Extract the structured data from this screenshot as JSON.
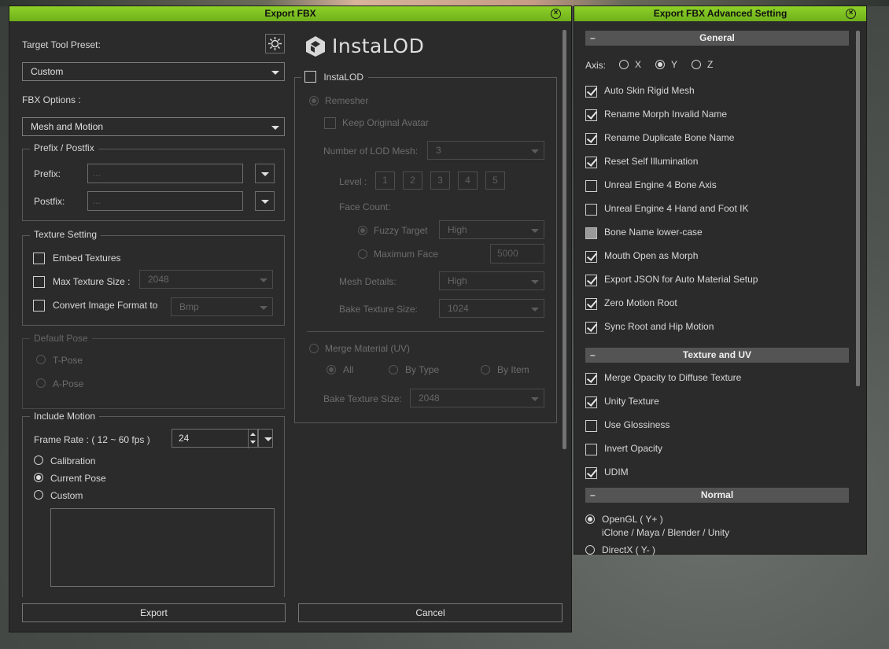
{
  "export_window": {
    "title": "Export FBX",
    "target_tool_preset_label": "Target Tool Preset:",
    "preset_value": "Custom",
    "fbx_options_label": "FBX Options :",
    "fbx_options_value": "Mesh and Motion",
    "prefix_group": {
      "title": "Prefix / Postfix",
      "prefix_label": "Prefix:",
      "prefix_placeholder": "...",
      "postfix_label": "Postfix:",
      "postfix_placeholder": "..."
    },
    "texture_group": {
      "title": "Texture Setting",
      "embed": "Embed Textures",
      "max_size": "Max Texture Size :",
      "max_size_value": "2048",
      "convert": "Convert Image Format to",
      "convert_value": "Bmp"
    },
    "pose_group": {
      "title": "Default Pose",
      "t_pose": "T-Pose",
      "a_pose": "A-Pose"
    },
    "motion_group": {
      "title": "Include Motion",
      "frame_rate_label": "Frame Rate : ( 12 ~ 60 fps )",
      "frame_rate_value": "24",
      "calibration": "Calibration",
      "current_pose": "Current Pose",
      "custom": "Custom"
    },
    "instalod": {
      "logo_text": "InstaLOD",
      "checkbox_label": "InstaLOD",
      "remesher": "Remesher",
      "keep_original": "Keep Original Avatar",
      "lod_count_label": "Number of LOD Mesh:",
      "lod_count_value": "3",
      "level_label": "Level :",
      "levels": [
        "1",
        "2",
        "3",
        "4",
        "5"
      ],
      "face_count_label": "Face Count:",
      "fuzzy_target": "Fuzzy Target",
      "fuzzy_value": "High",
      "max_face": "Maximum Face",
      "max_face_value": "5000",
      "mesh_details_label": "Mesh Details:",
      "mesh_details_value": "High",
      "bake_size_label": "Bake Texture Size:",
      "bake_size_value": "1024",
      "merge_material": "Merge Material (UV)",
      "all": "All",
      "by_type": "By Type",
      "by_item": "By Item",
      "merge_bake_label": "Bake Texture Size:",
      "merge_bake_value": "2048"
    },
    "export_button": "Export",
    "cancel_button": "Cancel"
  },
  "advanced_window": {
    "title": "Export FBX Advanced Setting",
    "general_header": "General",
    "axis_label": "Axis:",
    "axis_x": "X",
    "axis_y": "Y",
    "axis_z": "Z",
    "general_items": [
      {
        "label": "Auto Skin Rigid Mesh",
        "state": "checked"
      },
      {
        "label": "Rename Morph Invalid Name",
        "state": "checked"
      },
      {
        "label": "Rename Duplicate Bone Name",
        "state": "checked"
      },
      {
        "label": "Reset Self Illumination",
        "state": "checked"
      },
      {
        "label": "Unreal Engine 4 Bone Axis",
        "state": "unchecked"
      },
      {
        "label": "Unreal Engine 4 Hand and Foot IK",
        "state": "unchecked"
      },
      {
        "label": "Bone Name lower-case",
        "state": "partial"
      },
      {
        "label": "Mouth Open as Morph",
        "state": "checked"
      },
      {
        "label": "Export JSON for Auto Material Setup",
        "state": "checked"
      },
      {
        "label": "Zero Motion Root",
        "state": "checked"
      },
      {
        "label": "Sync Root and Hip Motion",
        "state": "checked"
      }
    ],
    "texture_header": "Texture and UV",
    "texture_items": [
      {
        "label": "Merge Opacity to Diffuse Texture",
        "state": "checked"
      },
      {
        "label": "Unity Texture",
        "state": "checked"
      },
      {
        "label": "Use Glossiness",
        "state": "unchecked"
      },
      {
        "label": "Invert Opacity",
        "state": "unchecked"
      },
      {
        "label": "UDIM",
        "state": "checked"
      }
    ],
    "normal_header": "Normal",
    "opengl": "OpenGL ( Y+ )",
    "opengl_sub": "iClone / Maya / Blender / Unity",
    "directx": "DirectX ( Y- )"
  }
}
